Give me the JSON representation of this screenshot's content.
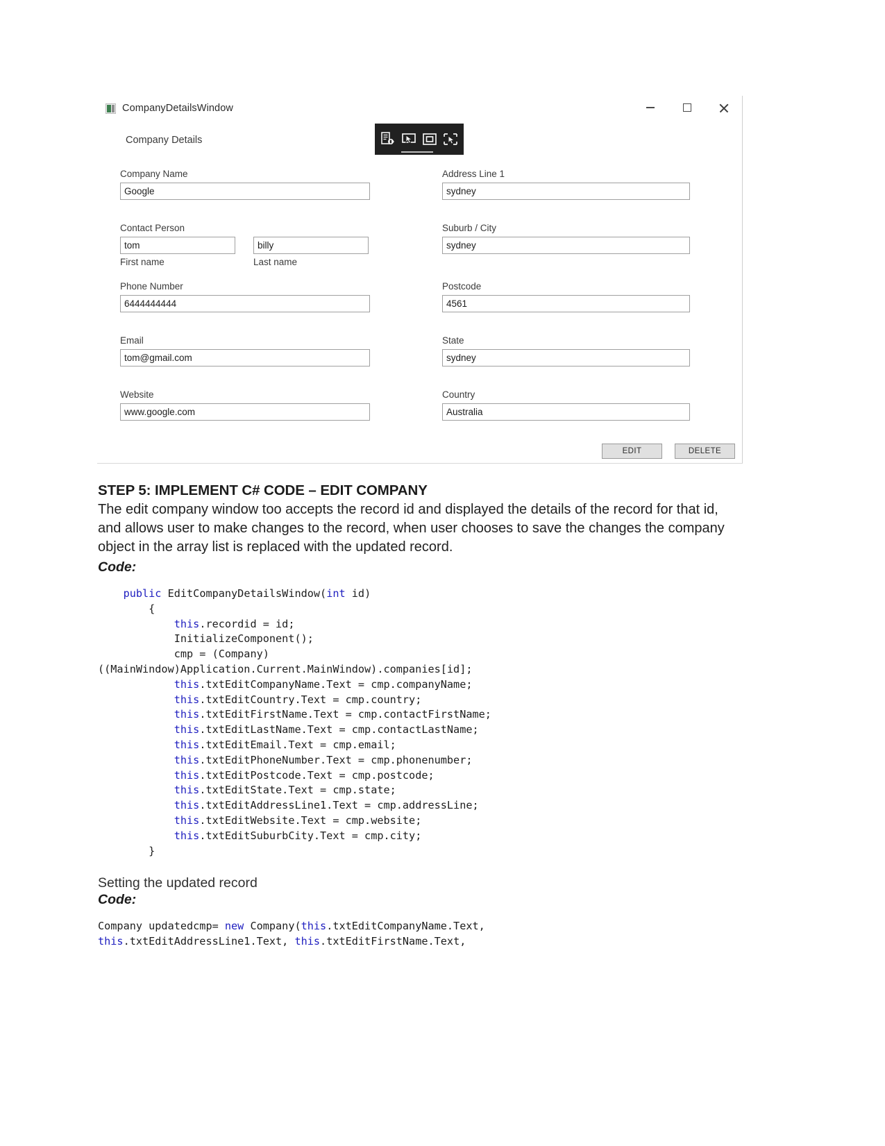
{
  "window": {
    "title": "CompanyDetailsWindow",
    "app_icon": "app-window-icon",
    "controls": {
      "minimize": "minimize-icon",
      "maximize": "maximize-icon",
      "close": "close-icon"
    },
    "capture_toolbar": {
      "icons": [
        "snip-region-icon",
        "cursor-capture-icon",
        "window-capture-icon",
        "free-capture-icon"
      ]
    },
    "form_heading": "Company Details",
    "fields": {
      "company_name": {
        "label": "Company Name",
        "value": "Google"
      },
      "contact_person": {
        "label": "Contact Person",
        "first": {
          "value": "tom",
          "sub": "First name"
        },
        "last": {
          "value": "billy",
          "sub": "Last name"
        }
      },
      "phone_number": {
        "label": "Phone Number",
        "value": "6444444444"
      },
      "email": {
        "label": "Email",
        "value": "tom@gmail.com"
      },
      "website": {
        "label": "Website",
        "value": "www.google.com"
      },
      "address_line_1": {
        "label": "Address Line 1",
        "value": "sydney"
      },
      "suburb_city": {
        "label": "Suburb / City",
        "value": "sydney"
      },
      "postcode": {
        "label": "Postcode",
        "value": "4561"
      },
      "state": {
        "label": "State",
        "value": "sydney"
      },
      "country": {
        "label": "Country",
        "value": "Australia"
      }
    },
    "buttons": {
      "edit": "EDIT",
      "delete": "DELETE"
    }
  },
  "document": {
    "heading": "STEP 5: IMPLEMENT C# CODE – EDIT COMPANY",
    "paragraph": "The edit company window too accepts the record id and displayed the details of the record for that id, and allows user to make changes to the record, when user chooses to save the changes the company object in the array list is replaced with the updated record.",
    "code_label": "Code:",
    "code": {
      "l01_kw": "public",
      "l01": " EditCompanyDetailsWindow(",
      "l01_kw2": "int",
      "l01b": " id)",
      "l02": "        {",
      "l03_kw": "this",
      "l03": ".recordid = id;",
      "l04": "            InitializeComponent();",
      "l05": "            cmp = (Company)",
      "l06": "((MainWindow)Application.Current.MainWindow).companies[id];",
      "l07": ".txtEditCompanyName.Text = cmp.companyName;",
      "l08": ".txtEditCountry.Text = cmp.country;",
      "l09": ".txtEditFirstName.Text = cmp.contactFirstName;",
      "l10": ".txtEditLastName.Text = cmp.contactLastName;",
      "l11": ".txtEditEmail.Text = cmp.email;",
      "l12": ".txtEditPhoneNumber.Text = cmp.phonenumber;",
      "l13": ".txtEditPostcode.Text = cmp.postcode;",
      "l14": ".txtEditState.Text = cmp.state;",
      "l15": ".txtEditAddressLine1.Text = cmp.addressLine;",
      "l16": ".txtEditWebsite.Text = cmp.website;",
      "l17": ".txtEditSuburbCity.Text = cmp.city;",
      "l18": "        }",
      "kw_this": "this"
    },
    "subheading": "Setting the updated record",
    "code_label2": "Code:",
    "code2": {
      "m01a": "Company updatedcmp= ",
      "m01_kw_new": "new",
      "m01b": " Company(",
      "m01_kw_this": "this",
      "m01c": ".txtEditCompanyName.Text,",
      "m02_kw_this": "this",
      "m02a": ".txtEditAddressLine1.Text, ",
      "m02_kw_this2": "this",
      "m02b": ".txtEditFirstName.Text,"
    }
  }
}
